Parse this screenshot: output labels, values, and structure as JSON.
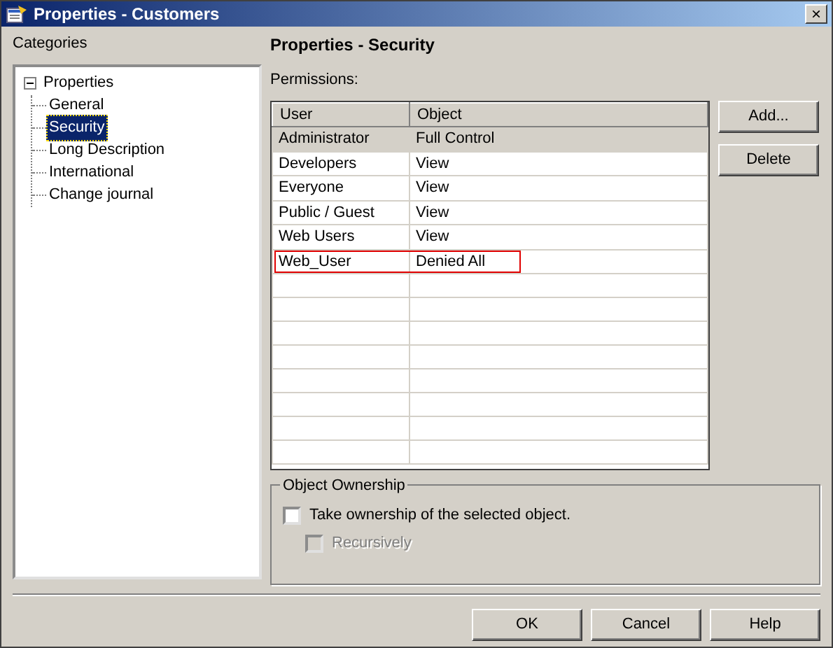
{
  "window": {
    "title": "Properties - Customers",
    "close": "×"
  },
  "categories": {
    "label": "Categories",
    "tree": [
      {
        "label": "Properties",
        "expanded": true,
        "selected": false,
        "children": [
          {
            "label": "General",
            "selected": false
          },
          {
            "label": "Security",
            "selected": true
          },
          {
            "label": "Long Description",
            "selected": false
          },
          {
            "label": "International",
            "selected": false
          },
          {
            "label": "Change journal",
            "selected": false
          }
        ]
      }
    ]
  },
  "page_title": "Properties - Security",
  "permissions": {
    "label": "Permissions:",
    "columns": [
      "User",
      "Object"
    ],
    "rows": [
      {
        "user": "Administrator",
        "object": "Full Control",
        "selected": true,
        "highlighted": false
      },
      {
        "user": "Developers",
        "object": "View",
        "selected": false,
        "highlighted": false
      },
      {
        "user": "Everyone",
        "object": "View",
        "selected": false,
        "highlighted": false
      },
      {
        "user": "Public / Guest",
        "object": "View",
        "selected": false,
        "highlighted": false
      },
      {
        "user": "Web Users",
        "object": "View",
        "selected": false,
        "highlighted": false
      },
      {
        "user": "Web_User",
        "object": "Denied All",
        "selected": false,
        "highlighted": true
      }
    ],
    "buttons": [
      "Add...",
      "Delete"
    ]
  },
  "ownership": {
    "title": "Object Ownership",
    "options": [
      {
        "label": "Take ownership of the selected object.",
        "checked": false,
        "disabled": false
      },
      {
        "label": "Recursively",
        "checked": false,
        "disabled": true
      }
    ]
  },
  "buttons": [
    "OK",
    "Cancel",
    "Help"
  ]
}
